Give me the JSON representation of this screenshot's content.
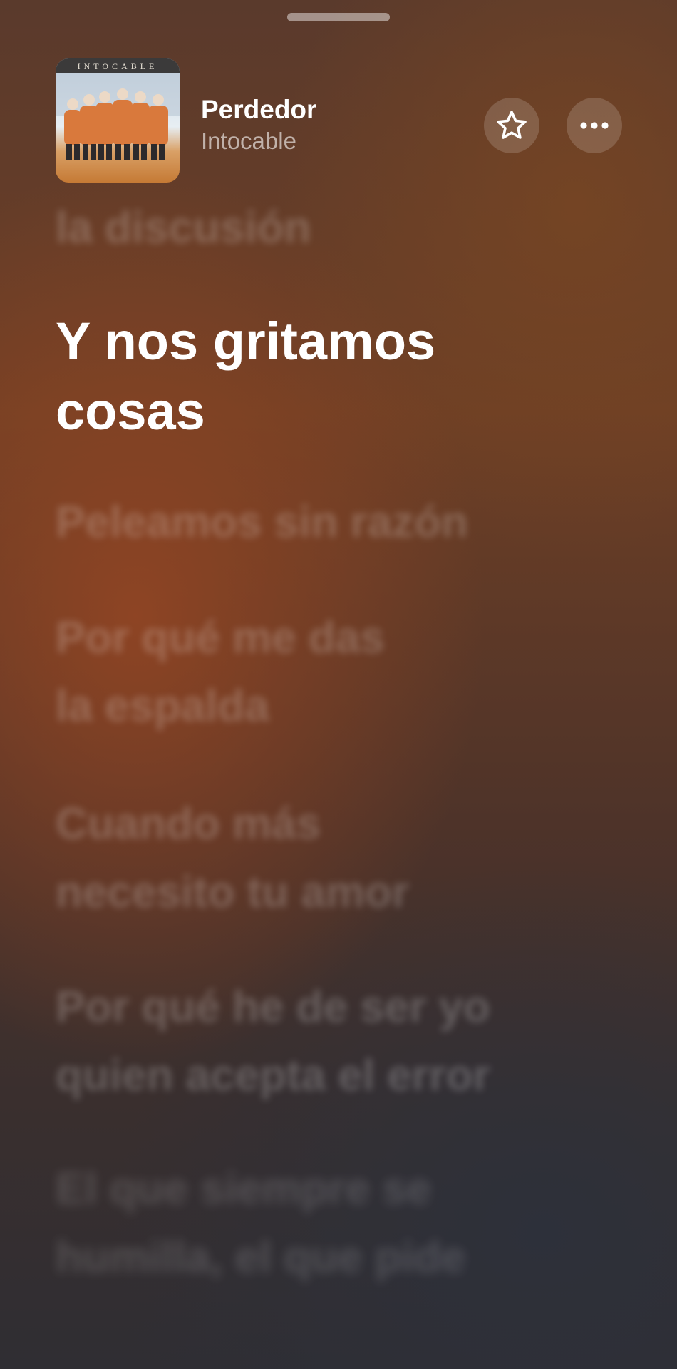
{
  "now_playing": {
    "title": "Perdedor",
    "artist": "Intocable",
    "album_art_text": "INTOCABLE"
  },
  "actions": {
    "favorite_icon": "star-icon",
    "more_icon": "ellipsis-icon"
  },
  "lyrics": {
    "previous": "la discusión",
    "current": [
      "Y nos gritamos",
      "cosas"
    ],
    "upcoming": [
      [
        "Peleamos sin razón"
      ],
      [
        "Por qué me das",
        "la espalda"
      ],
      [
        "Cuando más",
        "necesito tu amor"
      ],
      [
        "Por qué he de ser yo",
        "quien acepta el error"
      ],
      [
        "El que siempre se",
        "humilla, el que pide"
      ]
    ]
  },
  "colors": {
    "text_primary": "#ffffff",
    "text_secondary": "rgba(255,255,255,0.6)",
    "background_warm": "#6e3f25",
    "background_cool": "#2f2e33"
  }
}
